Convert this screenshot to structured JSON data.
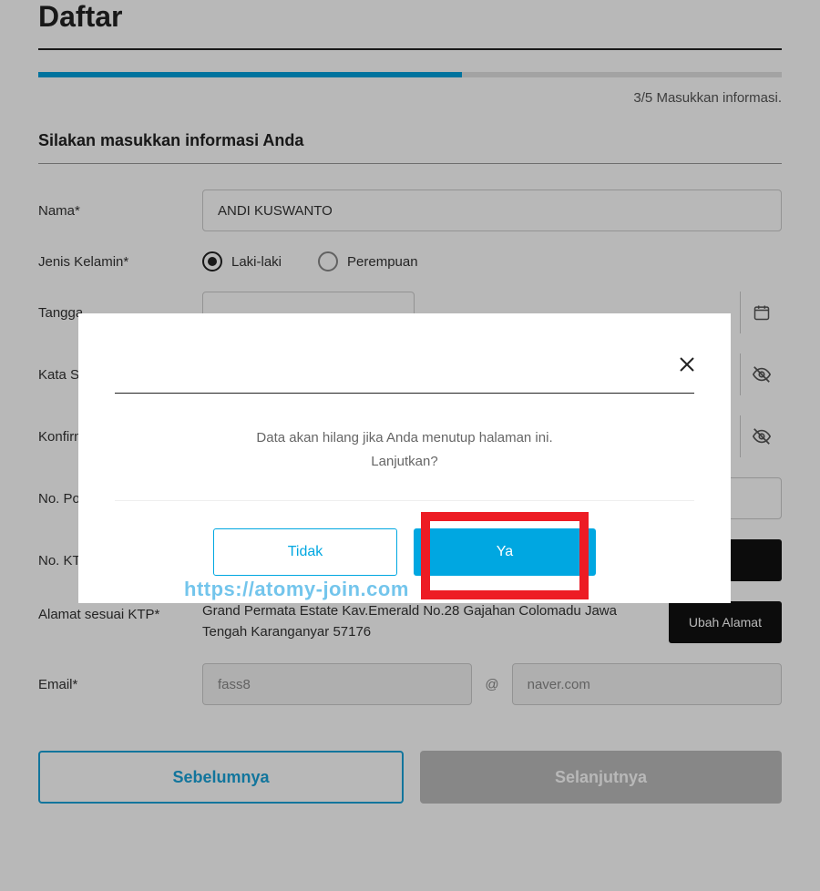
{
  "page": {
    "title": "Daftar",
    "step_current": "3",
    "step_total": "/5",
    "step_label": " Masukkan informasi.",
    "section_heading": "Silakan masukkan informasi Anda"
  },
  "fields": {
    "nama": {
      "label": "Nama*",
      "value": "ANDI KUSWANTO"
    },
    "jenis_kelamin": {
      "label": "Jenis Kelamin*",
      "option_male": "Laki-laki",
      "option_female": "Perempuan"
    },
    "tanggal": {
      "label": "Tangga"
    },
    "kata_sandi": {
      "label": "Kata Sa"
    },
    "konfirmasi": {
      "label": "Konfirm"
    },
    "no_ponsel": {
      "label": "No. Po"
    },
    "no_ktp": {
      "label": "No. KT"
    },
    "alamat": {
      "label": "Alamat sesuai KTP*",
      "value": "Grand Permata Estate Kav.Emerald No.28 Gajahan Colomadu Jawa Tengah Karanganyar 57176",
      "button": "Ubah Alamat"
    },
    "email": {
      "label": "Email*",
      "user": "fass8",
      "at": "@",
      "domain": "naver.com"
    }
  },
  "footer": {
    "prev": "Sebelumnya",
    "next": "Selanjutnya"
  },
  "modal": {
    "line1": "Data akan hilang jika Anda menutup halaman ini.",
    "line2": "Lanjutkan?",
    "btn_no": "Tidak",
    "btn_yes": "Ya"
  },
  "watermark": "https://atomy-join.com"
}
